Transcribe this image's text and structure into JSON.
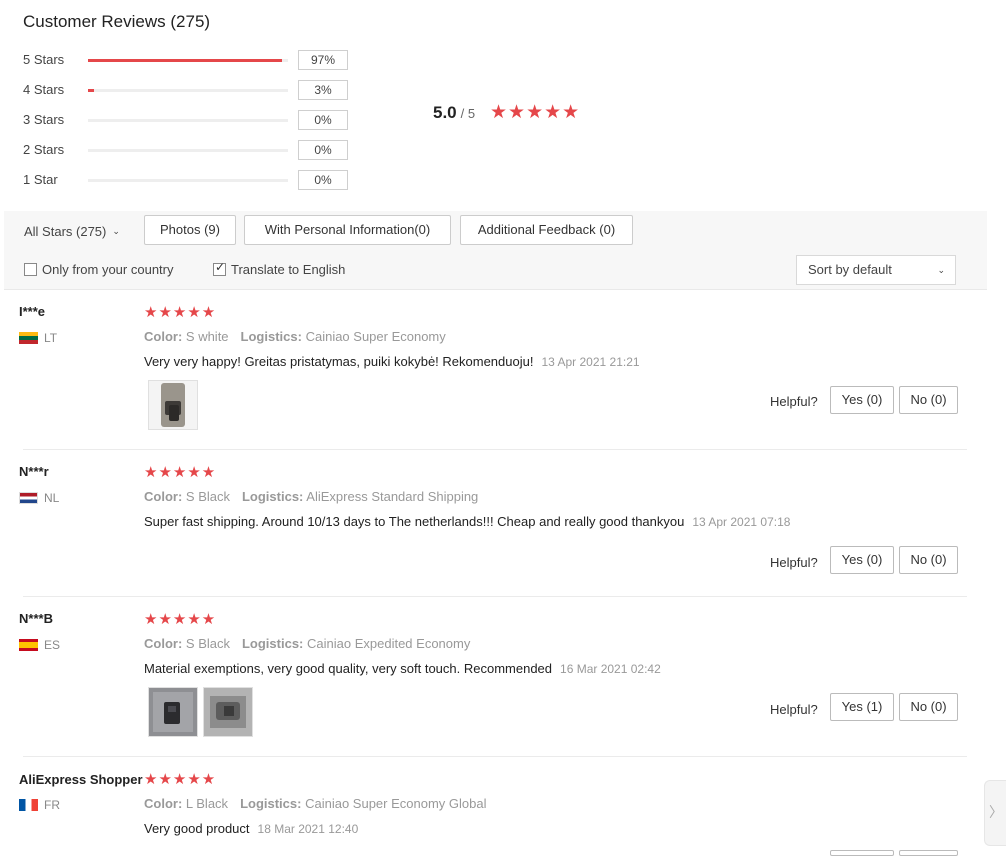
{
  "header": {
    "title": "Customer Reviews (275)"
  },
  "rating_distribution": [
    {
      "label": "5 Stars",
      "percent": 97,
      "percent_label": "97%"
    },
    {
      "label": "4 Stars",
      "percent": 3,
      "percent_label": "3%"
    },
    {
      "label": "3 Stars",
      "percent": 0,
      "percent_label": "0%"
    },
    {
      "label": "2 Stars",
      "percent": 0,
      "percent_label": "0%"
    },
    {
      "label": "1 Star",
      "percent": 0,
      "percent_label": "0%"
    }
  ],
  "summary": {
    "score": "5.0",
    "out_of": "/ 5",
    "stars": "★★★★★"
  },
  "filters": {
    "all_stars": "All Stars (275)",
    "photos": "Photos (9)",
    "personal_info": "With Personal Information(0)",
    "additional_feedback": "Additional Feedback (0)",
    "only_country": "Only from your country",
    "only_country_checked": false,
    "translate": "Translate to English",
    "translate_checked": true,
    "sort_value": "Sort by default"
  },
  "reviews": [
    {
      "user": "I***e",
      "country": "LT",
      "stars": "★★★★★",
      "color_label": "Color:",
      "color": "S white",
      "logistics_label": "Logistics:",
      "logistics": "Cainiao Super Economy",
      "text": "Very very happy! Greitas pristatymas, puiki kokybė! Rekomenduoju!",
      "date": "13 Apr 2021 21:21",
      "helpful_label": "Helpful?",
      "yes": "Yes (0)",
      "no": "No (0)"
    },
    {
      "user": "N***r",
      "country": "NL",
      "stars": "★★★★★",
      "color_label": "Color:",
      "color": "S Black",
      "logistics_label": "Logistics:",
      "logistics": "AliExpress Standard Shipping",
      "text": "Super fast shipping. Around 10/13 days to The netherlands!!! Cheap and really good thankyou",
      "date": "13 Apr 2021 07:18",
      "helpful_label": "Helpful?",
      "yes": "Yes (0)",
      "no": "No (0)"
    },
    {
      "user": "N***B",
      "country": "ES",
      "stars": "★★★★★",
      "color_label": "Color:",
      "color": "S Black",
      "logistics_label": "Logistics:",
      "logistics": "Cainiao Expedited Economy",
      "text": "Material exemptions, very good quality, very soft touch. Recommended",
      "date": "16 Mar 2021 02:42",
      "helpful_label": "Helpful?",
      "yes": "Yes (1)",
      "no": "No (0)"
    },
    {
      "user": "AliExpress Shopper",
      "country": "FR",
      "stars": "★★★★★",
      "color_label": "Color:",
      "color": "L Black",
      "logistics_label": "Logistics:",
      "logistics": "Cainiao Super Economy Global",
      "text": "Very good product",
      "date": "18 Mar 2021 12:40"
    }
  ],
  "colors": {
    "accent": "#e5474a",
    "muted": "#999999"
  },
  "icons": {
    "dropdown": "chevron-down-icon",
    "side": "chevron-right-icon"
  }
}
